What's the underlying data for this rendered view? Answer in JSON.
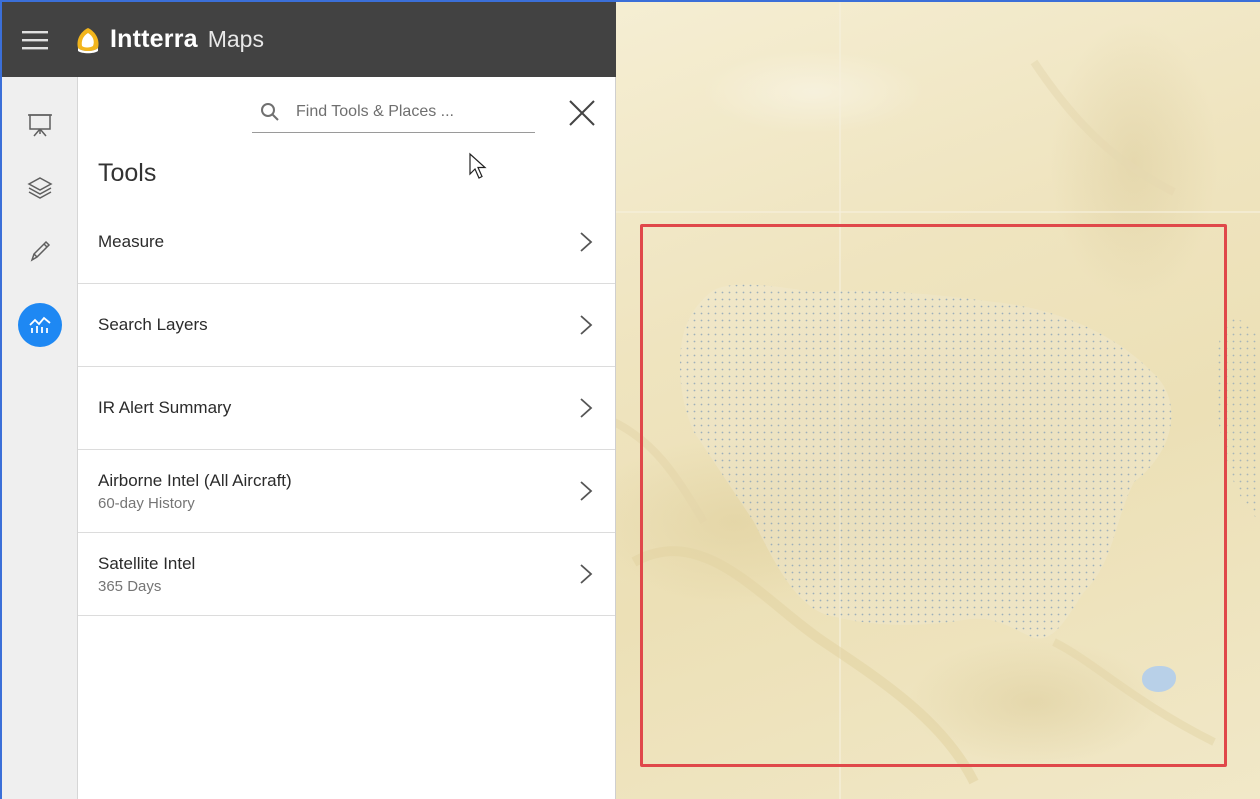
{
  "app": {
    "brand": "Intterra",
    "subtitle": "Maps"
  },
  "search": {
    "placeholder": "Find Tools & Places ..."
  },
  "panel": {
    "title": "Tools",
    "items": [
      {
        "label": "Measure",
        "sub": ""
      },
      {
        "label": "Search Layers",
        "sub": ""
      },
      {
        "label": "IR Alert Summary",
        "sub": ""
      },
      {
        "label": "Airborne Intel (All Aircraft)",
        "sub": "60-day History"
      },
      {
        "label": "Satellite Intel",
        "sub": "365 Days"
      }
    ]
  },
  "rail": {
    "items": [
      "presentation-icon",
      "layers-icon",
      "pencil-icon",
      "analytics-icon"
    ],
    "active": "analytics-icon"
  },
  "colors": {
    "appbar": "#424242",
    "accent": "#1e88f3",
    "aoi_border": "#e0484a",
    "map_base": "#efe4bf"
  }
}
